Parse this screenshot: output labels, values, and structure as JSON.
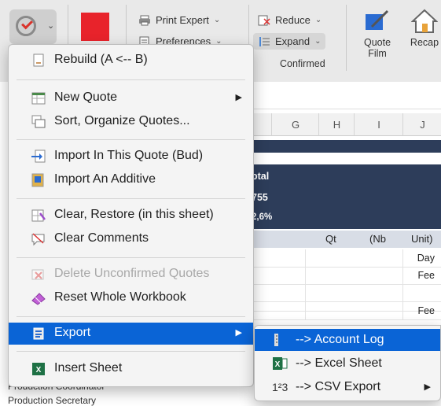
{
  "ribbon": {
    "print_expert": "Print Expert",
    "preferences": "Preferences",
    "reduce": "Reduce",
    "expand": "Expand",
    "confirmed": "Confirmed",
    "quote_film": "Quote Film",
    "recap": "Recap",
    "chevron": "⌄",
    "colors": {
      "swatch": "#e8232b",
      "accent": "#0a64d6"
    }
  },
  "sheet": {
    "columns": [
      "G",
      "H",
      "I",
      "J"
    ],
    "dark_band": [
      "otal",
      "755",
      "2,6%"
    ],
    "header_row": [
      "Qt",
      "(Nb",
      "Unit)"
    ],
    "rows": [
      "Day",
      "Fee",
      "",
      "",
      "Fee"
    ],
    "bottom_texts": [
      "Production Coordinator",
      "Production Secretary"
    ]
  },
  "menu": {
    "items": [
      {
        "label": "Rebuild (A <-- B)",
        "icon": "rebuild-icon"
      },
      {
        "label": "New Quote",
        "icon": "new-quote-icon",
        "submenu": true
      },
      {
        "label": "Sort, Organize Quotes...",
        "icon": "sort-icon"
      },
      {
        "label": "Import In This Quote (Bud)",
        "icon": "import-icon"
      },
      {
        "label": "Import An Additive",
        "icon": "additive-icon"
      },
      {
        "label": "Clear, Restore (in this sheet)",
        "icon": "clear-restore-icon"
      },
      {
        "label": "Clear Comments",
        "icon": "clear-comments-icon"
      },
      {
        "label": "Delete Unconfirmed Quotes",
        "icon": "delete-icon",
        "disabled": true
      },
      {
        "label": "Reset Whole Workbook",
        "icon": "eraser-icon"
      },
      {
        "label": "Export",
        "icon": "export-icon",
        "submenu": true,
        "highlighted": true
      },
      {
        "label": "Insert Sheet",
        "icon": "excel-icon"
      }
    ],
    "arrow": "▶"
  },
  "submenu": {
    "items": [
      {
        "label": "--> Account Log",
        "icon": "account-log-icon",
        "highlighted": true
      },
      {
        "label": "--> Excel Sheet",
        "icon": "excel-icon"
      },
      {
        "label": "--> CSV Export",
        "icon": "csv-icon",
        "glyph": "1²3",
        "submenu": true
      }
    ]
  }
}
